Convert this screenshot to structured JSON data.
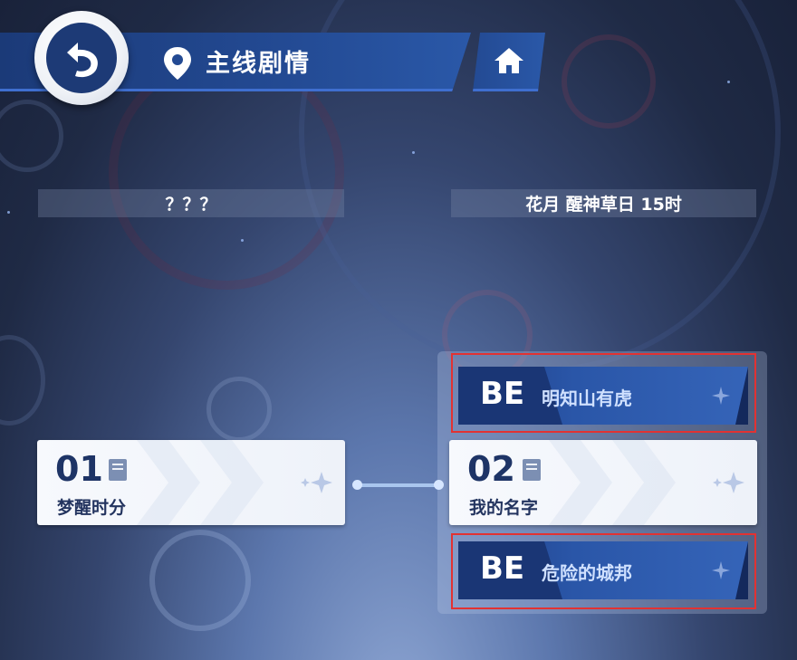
{
  "header": {
    "title": "主线剧情"
  },
  "periods": [
    {
      "label": "？？？"
    },
    {
      "label": "花月 醒神草日 15时"
    }
  ],
  "chapters": [
    {
      "number": "01",
      "title": "梦醒时分"
    },
    {
      "number": "02",
      "title": "我的名字"
    }
  ],
  "endings": [
    {
      "tag": "BE",
      "name": "明知山有虎"
    },
    {
      "tag": "BE",
      "name": "危险的城邦"
    }
  ],
  "colors": {
    "header_blue": "#234a93",
    "highlight_red": "#e23232",
    "card_text": "#1e3466"
  },
  "icons": [
    "back-arrow-icon",
    "location-pin-icon",
    "home-icon",
    "book-icon",
    "sparkle-icon"
  ]
}
